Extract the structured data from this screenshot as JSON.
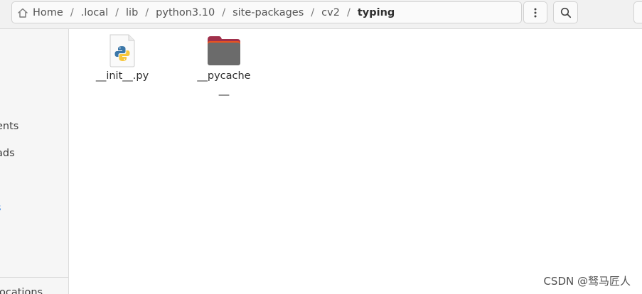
{
  "pathbar": {
    "crumbs": [
      {
        "label": "Home",
        "icon": "home-icon"
      },
      {
        "label": ".local"
      },
      {
        "label": "lib"
      },
      {
        "label": "python3.10"
      },
      {
        "label": "site-packages"
      },
      {
        "label": "cv2"
      },
      {
        "label": "typing",
        "current": true
      }
    ],
    "separator": "/"
  },
  "toolbar": {
    "menu_icon": "vertical-ellipsis-icon",
    "search_icon": "search-icon"
  },
  "sidebar": {
    "items": [
      {
        "label": "ents"
      },
      {
        "label": "ads"
      },
      {
        "label": "s"
      },
      {
        "label": "ocations"
      }
    ]
  },
  "files": [
    {
      "name": "__init__.py",
      "type": "python-file",
      "icon": "python-file-icon"
    },
    {
      "name": "__pycache__",
      "type": "folder",
      "icon": "folder-icon"
    }
  ],
  "watermark": "CSDN @驽马匠人",
  "colors": {
    "folder_body": "#6b6b6b",
    "folder_tab": "#a0304b",
    "folder_edge": "#e95420",
    "link_blue": "#3584e4"
  }
}
